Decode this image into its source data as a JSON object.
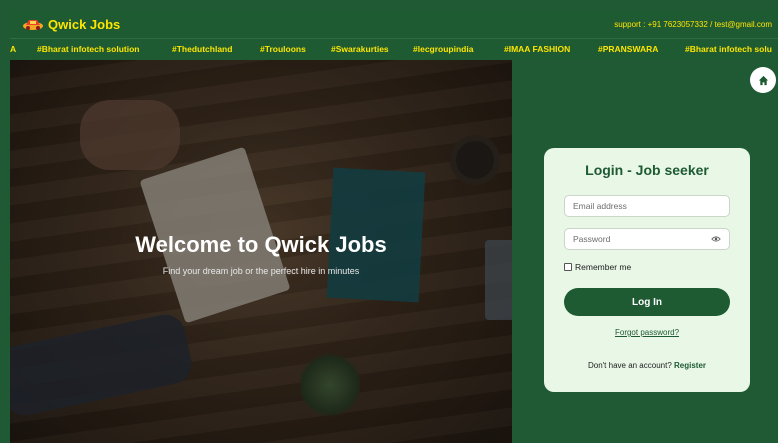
{
  "header": {
    "brand": "Qwick Jobs",
    "support": "support : +91 7623057332 / test@gmail.com",
    "logo_icon": "car-logo-icon"
  },
  "ticker": {
    "items": [
      "A",
      "#Bharat infotech solution",
      "#Thedutchland",
      "#Trouloons",
      "#Swarakurties",
      "#lecgroupindia",
      "#IMAA FASHION",
      "#PRANSWARA",
      "#Bharat infotech solu"
    ]
  },
  "hero": {
    "title": "Welcome to Qwick Jobs",
    "subtitle": "Find your dream job or the perfect hire in minutes"
  },
  "login": {
    "title": "Login - Job seeker",
    "email_placeholder": "Email address",
    "password_placeholder": "Password",
    "remember_label": "Remember me",
    "button_label": "Log In",
    "forgot_label": "Forgot password?",
    "no_account_text": "Don't have an account?",
    "register_label": "Register"
  },
  "colors": {
    "primary_green": "#1e5a32",
    "accent_yellow": "#fde600",
    "card_bg": "#e8f7e6"
  }
}
